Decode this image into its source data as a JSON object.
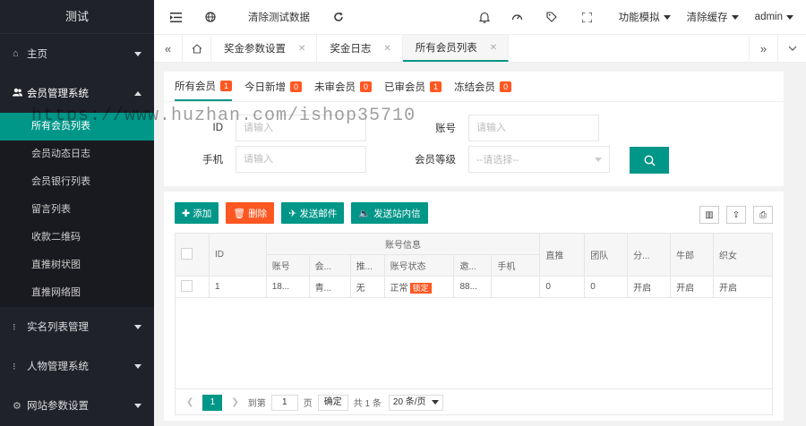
{
  "sidebar": {
    "logo": "测试",
    "menu": [
      {
        "label": "主页",
        "icon": "home-icon",
        "glyph": "⌂"
      },
      {
        "label": "会员管理系统",
        "icon": "users-icon",
        "glyph": "👥"
      },
      {
        "label": "实名列表管理",
        "icon": "dots-icon",
        "glyph": "⁝"
      },
      {
        "label": "人物管理系统",
        "icon": "dots-icon",
        "glyph": "⁝"
      },
      {
        "label": "网站参数设置",
        "icon": "gear-icon",
        "glyph": "⚙"
      }
    ],
    "submenu": [
      "所有会员列表",
      "会员动态日志",
      "会员银行列表",
      "留言列表",
      "收款二维码",
      "直推树状图",
      "直推网络图"
    ]
  },
  "header": {
    "clear_data": "清除测试数据",
    "func_sim": "功能模拟",
    "clear_cache": "清除缓存",
    "user": "admin"
  },
  "tabs": [
    "奖金参数设置",
    "奖金日志",
    "所有会员列表"
  ],
  "subtabs": [
    {
      "label": "所有会员",
      "count": "1"
    },
    {
      "label": "今日新增",
      "count": "0"
    },
    {
      "label": "未审会员",
      "count": "0"
    },
    {
      "label": "已审会员",
      "count": "1"
    },
    {
      "label": "冻结会员",
      "count": "0"
    }
  ],
  "form": {
    "id_label": "ID",
    "account_label": "账号",
    "phone_label": "手机",
    "level_label": "会员等级",
    "placeholder": "请输入",
    "select_placeholder": "--请选择--"
  },
  "watermark": "https://www.huzhan.com/ishop35710",
  "toolbar": {
    "add": "添加",
    "delete": "删除",
    "send_mail": "发送邮件",
    "send_msg": "发送站内信"
  },
  "table": {
    "group_header": "账号信息",
    "top_headers": [
      "ID",
      "直推",
      "团队",
      "分...",
      "牛郎",
      "织女"
    ],
    "sub_headers": [
      "账号",
      "会...",
      "推...",
      "账号状态",
      "邀...",
      "手机"
    ],
    "row": {
      "id": "1",
      "account": "18...",
      "member": "青...",
      "referrer": "无",
      "status": "正常",
      "status_badge": "锁定",
      "invite": "88...",
      "phone": "",
      "direct": "0",
      "team": "0",
      "share": "开启",
      "cowherd": "开启",
      "weaver": "开启"
    }
  },
  "pager": {
    "current": "1",
    "goto": "到第",
    "page_input": "1",
    "page_unit": "页",
    "confirm": "确定",
    "total": "共 1 条",
    "per_page": "20 条/页"
  }
}
